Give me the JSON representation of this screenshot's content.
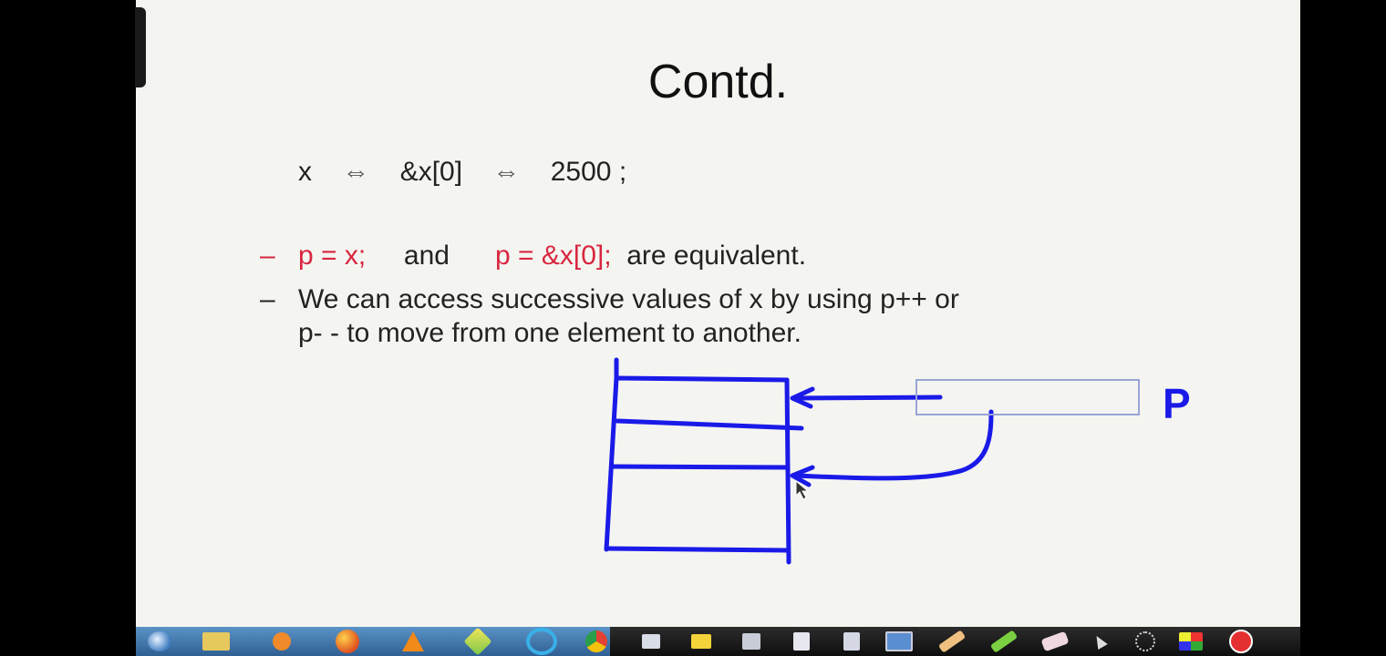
{
  "slide": {
    "title": "Contd.",
    "equivalence": {
      "lhs": "x",
      "op1": "⇔",
      "mid": "&x[0]",
      "op2": "⇔",
      "rhs": "2500 ;"
    },
    "bullets": [
      {
        "dash": "–",
        "code1": "p = x;",
        "joiner": "and",
        "code2": "p = &x[0];",
        "rest": "are equivalent."
      },
      {
        "dash": "–",
        "line1": "We can access successive values of x by using p++ or",
        "line2": "p- - to move from one element to another."
      }
    ],
    "pointer_label": "P"
  },
  "colors": {
    "slide_bg": "#f4f5f1",
    "text": "#222222",
    "accent_red": "#d8263e",
    "ink_blue": "#1a1ae8"
  },
  "taskbar": {
    "icons": [
      "start-orb-icon",
      "folder-icon",
      "media-player-icon",
      "firefox-icon",
      "vlc-icon",
      "cursor-tool-icon",
      "ie-icon",
      "chrome-icon",
      "pen-tool-icon",
      "highlighter-icon",
      "screen-tool-icon",
      "page-tool-icon",
      "document-tool-icon",
      "monitor-icon",
      "marker-tool-icon",
      "green-marker-icon",
      "eraser-icon",
      "pointer-icon",
      "move-icon",
      "color-palette-icon",
      "close-circle-icon"
    ]
  }
}
